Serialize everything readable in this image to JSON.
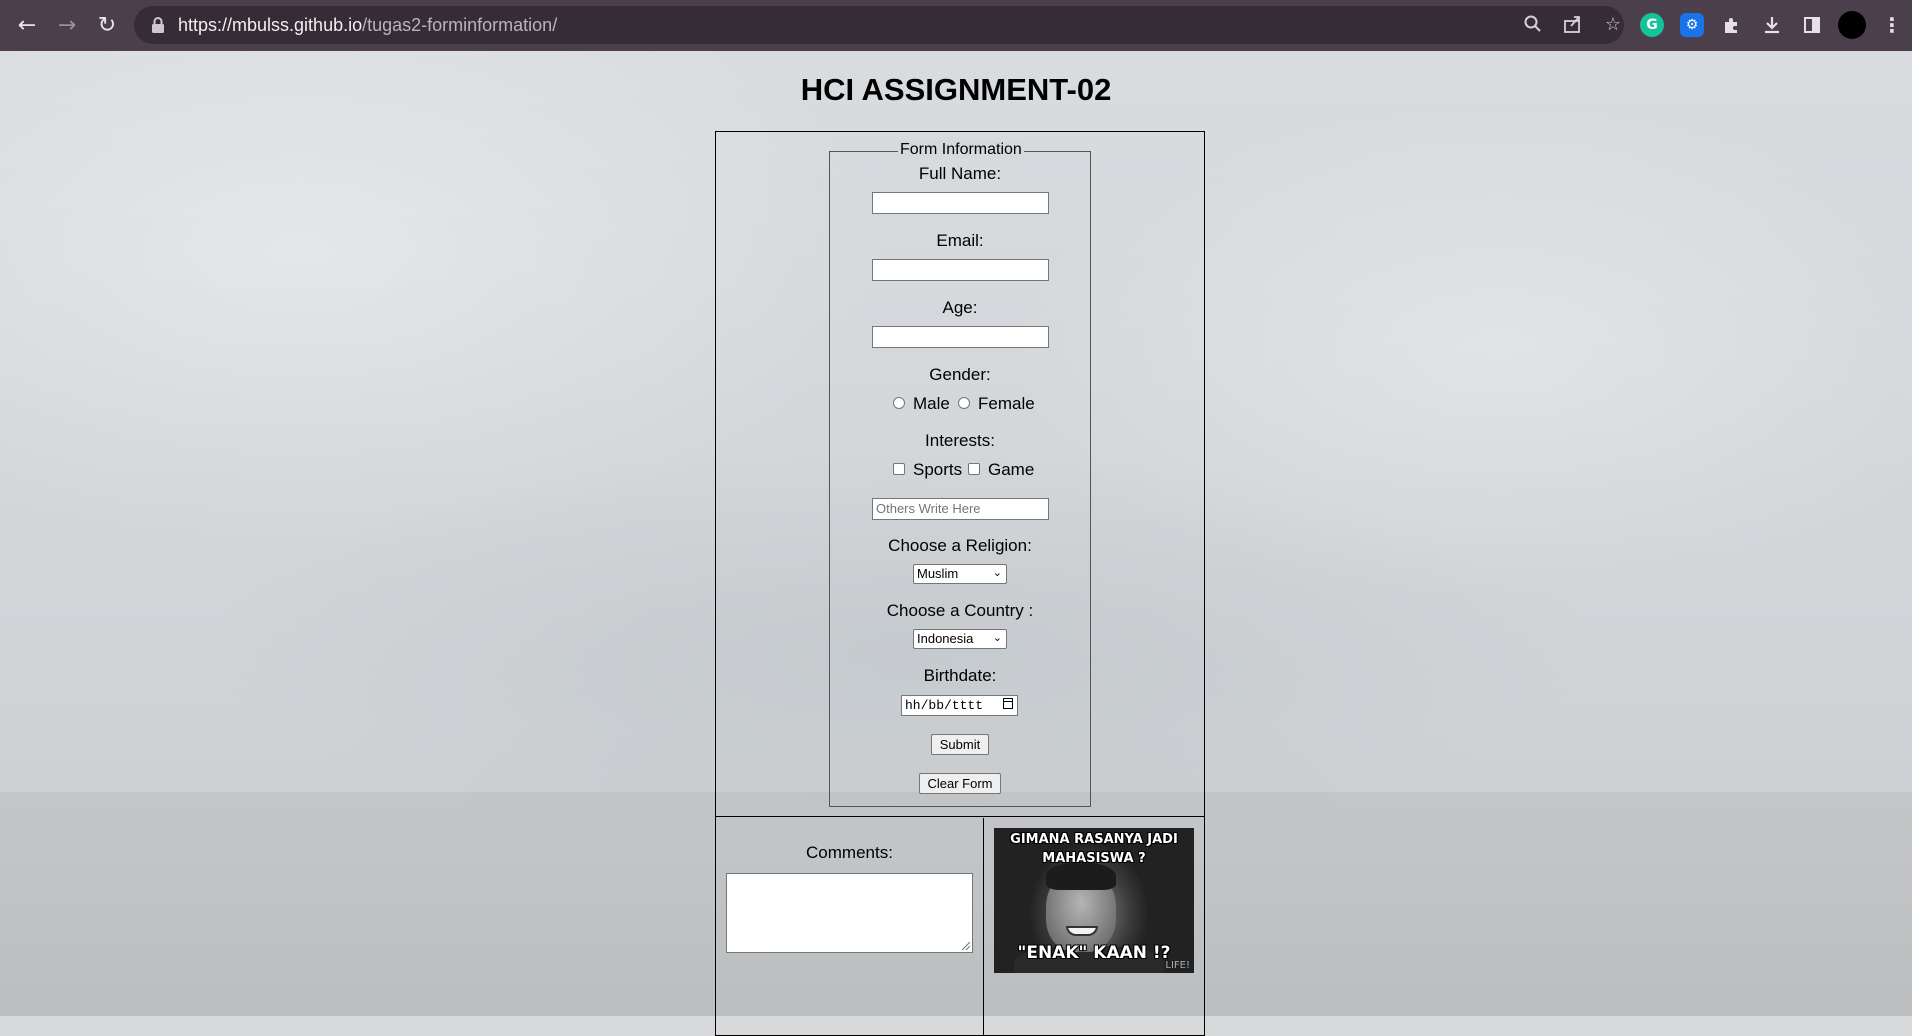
{
  "browser": {
    "url_host": "https://mbulss.github.io",
    "url_path": "/tugas2-forminformation/"
  },
  "page": {
    "title": "HCI ASSIGNMENT-02"
  },
  "form": {
    "legend": "Form Information",
    "full_name_label": "Full Name:",
    "full_name_value": "",
    "email_label": "Email:",
    "email_value": "",
    "age_label": "Age:",
    "age_value": "",
    "gender_label": "Gender:",
    "gender_options": [
      "Male",
      "Female"
    ],
    "interests_label": "Interests:",
    "interest_options": [
      "Sports",
      "Game"
    ],
    "others_placeholder": "Others Write Here",
    "religion_label": "Choose a Religion:",
    "religion_selected": "Muslim",
    "country_label": "Choose a Country :",
    "country_selected": "Indonesia",
    "birthdate_label": "Birthdate:",
    "birthdate_placeholder": "hh/bb/tttt",
    "submit_label": "Submit",
    "clear_label": "Clear Form"
  },
  "comments": {
    "label": "Comments:",
    "value": ""
  },
  "meme": {
    "caption_top_line1": "GIMANA RASANYA JADI",
    "caption_top_line2": "MAHASISWA ?",
    "caption_bottom": "\"ENAK\" KAAN !?",
    "watermark": "LIFE!"
  },
  "colors": {
    "chrome_bg": "#4a3f4a",
    "omnibox_bg": "#352c35",
    "grammarly": "#15c39a",
    "ext_blue": "#1a73e8"
  }
}
